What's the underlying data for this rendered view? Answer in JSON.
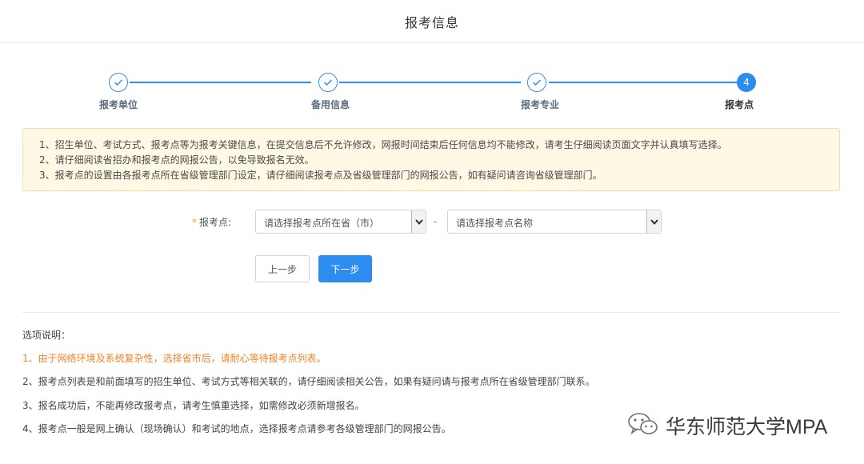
{
  "header": {
    "title": "报考信息"
  },
  "steps": [
    {
      "label": "报考单位",
      "state": "done"
    },
    {
      "label": "备用信息",
      "state": "done"
    },
    {
      "label": "报考专业",
      "state": "done"
    },
    {
      "label": "报考点",
      "state": "active",
      "number": "4"
    }
  ],
  "notice": {
    "lines": [
      "1、招生单位、考试方式、报考点等为报考关键信息，在提交信息后不允许修改，网报时间结束后任何信息均不能修改，请考生仔细阅读页面文字并认真填写选择。",
      "2、请仔细阅读省招办和报考点的网报公告，以免导致报名无效。",
      "3、报考点的设置由各报考点所在省级管理部门设定，请仔细阅读报考点及省级管理部门的网报公告，如有疑问请咨询省级管理部门。"
    ]
  },
  "form": {
    "required_mark": "*",
    "label": "报考点:",
    "province_select": "请选择报考点所在省（市）",
    "separator": "-",
    "site_select": "请选择报考点名称"
  },
  "buttons": {
    "prev": "上一步",
    "next": "下一步"
  },
  "explanation": {
    "title": "选项说明：",
    "items": [
      "1、由于网络环境及系统复杂性，选择省市后，请耐心等待报考点列表。",
      "2、报考点列表是和前面填写的招生单位、考试方式等相关联的，请仔细阅读相关公告，如果有疑问请与报考点所在省级管理部门联系。",
      "3、报名成功后，不能再修改报考点，请考生慎重选择，如需修改必须新增报名。",
      "4、报考点一般是网上确认（现场确认）和考试的地点，选择报考点请参考各级管理部门的网报公告。"
    ]
  },
  "watermark": {
    "text": "华东师范大学MPA",
    "icon": "wechat-icon"
  },
  "colors": {
    "accent": "#2d8cf0",
    "warning": "#f5822a",
    "notice_bg": "#fff8e4"
  }
}
